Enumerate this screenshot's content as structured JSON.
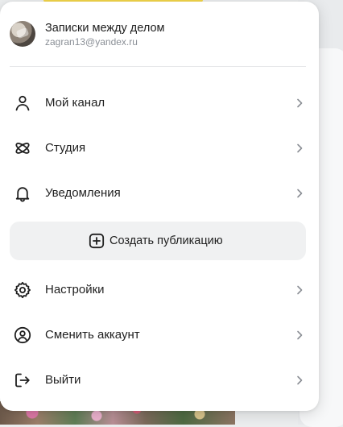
{
  "profile": {
    "name": "Записки между делом",
    "email": "zagran13@yandex.ru"
  },
  "menu": {
    "items_top": [
      {
        "label": "Мой канал",
        "icon": "user-icon"
      },
      {
        "label": "Студия",
        "icon": "studio-icon"
      },
      {
        "label": "Уведомления",
        "icon": "bell-icon"
      }
    ],
    "create_button": {
      "label": "Создать публикацию",
      "icon": "plus-square-icon"
    },
    "items_bottom": [
      {
        "label": "Настройки",
        "icon": "gear-icon"
      },
      {
        "label": "Сменить аккаунт",
        "icon": "user-circle-icon"
      },
      {
        "label": "Выйти",
        "icon": "logout-icon"
      }
    ]
  },
  "colors": {
    "menu_background": "#ffffff",
    "create_button_background": "#f0f1f2",
    "text": "#1f1f1f",
    "secondary_text": "#8a8f96",
    "accent": "#f3d64a"
  }
}
